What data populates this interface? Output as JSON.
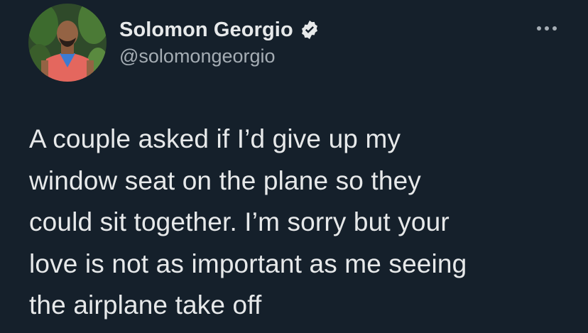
{
  "author": {
    "display_name": "Solomon Georgio",
    "handle": "@solomongeorgio",
    "verified": true,
    "avatar_icon": "profile-photo-icon",
    "verified_icon": "verified-badge-icon"
  },
  "menu": {
    "more_icon": "more-options-icon"
  },
  "tweet": {
    "text": "A couple asked if I’d give up my\nwindow seat on the plane so they\ncould sit together. I’m sorry but your\nlove is not as important as me seeing\nthe airplane take off"
  },
  "colors": {
    "background": "#15202b",
    "text": "#e7e9ea",
    "secondary_text": "#a5adb4",
    "verified_badge": "#e7e9ea"
  }
}
